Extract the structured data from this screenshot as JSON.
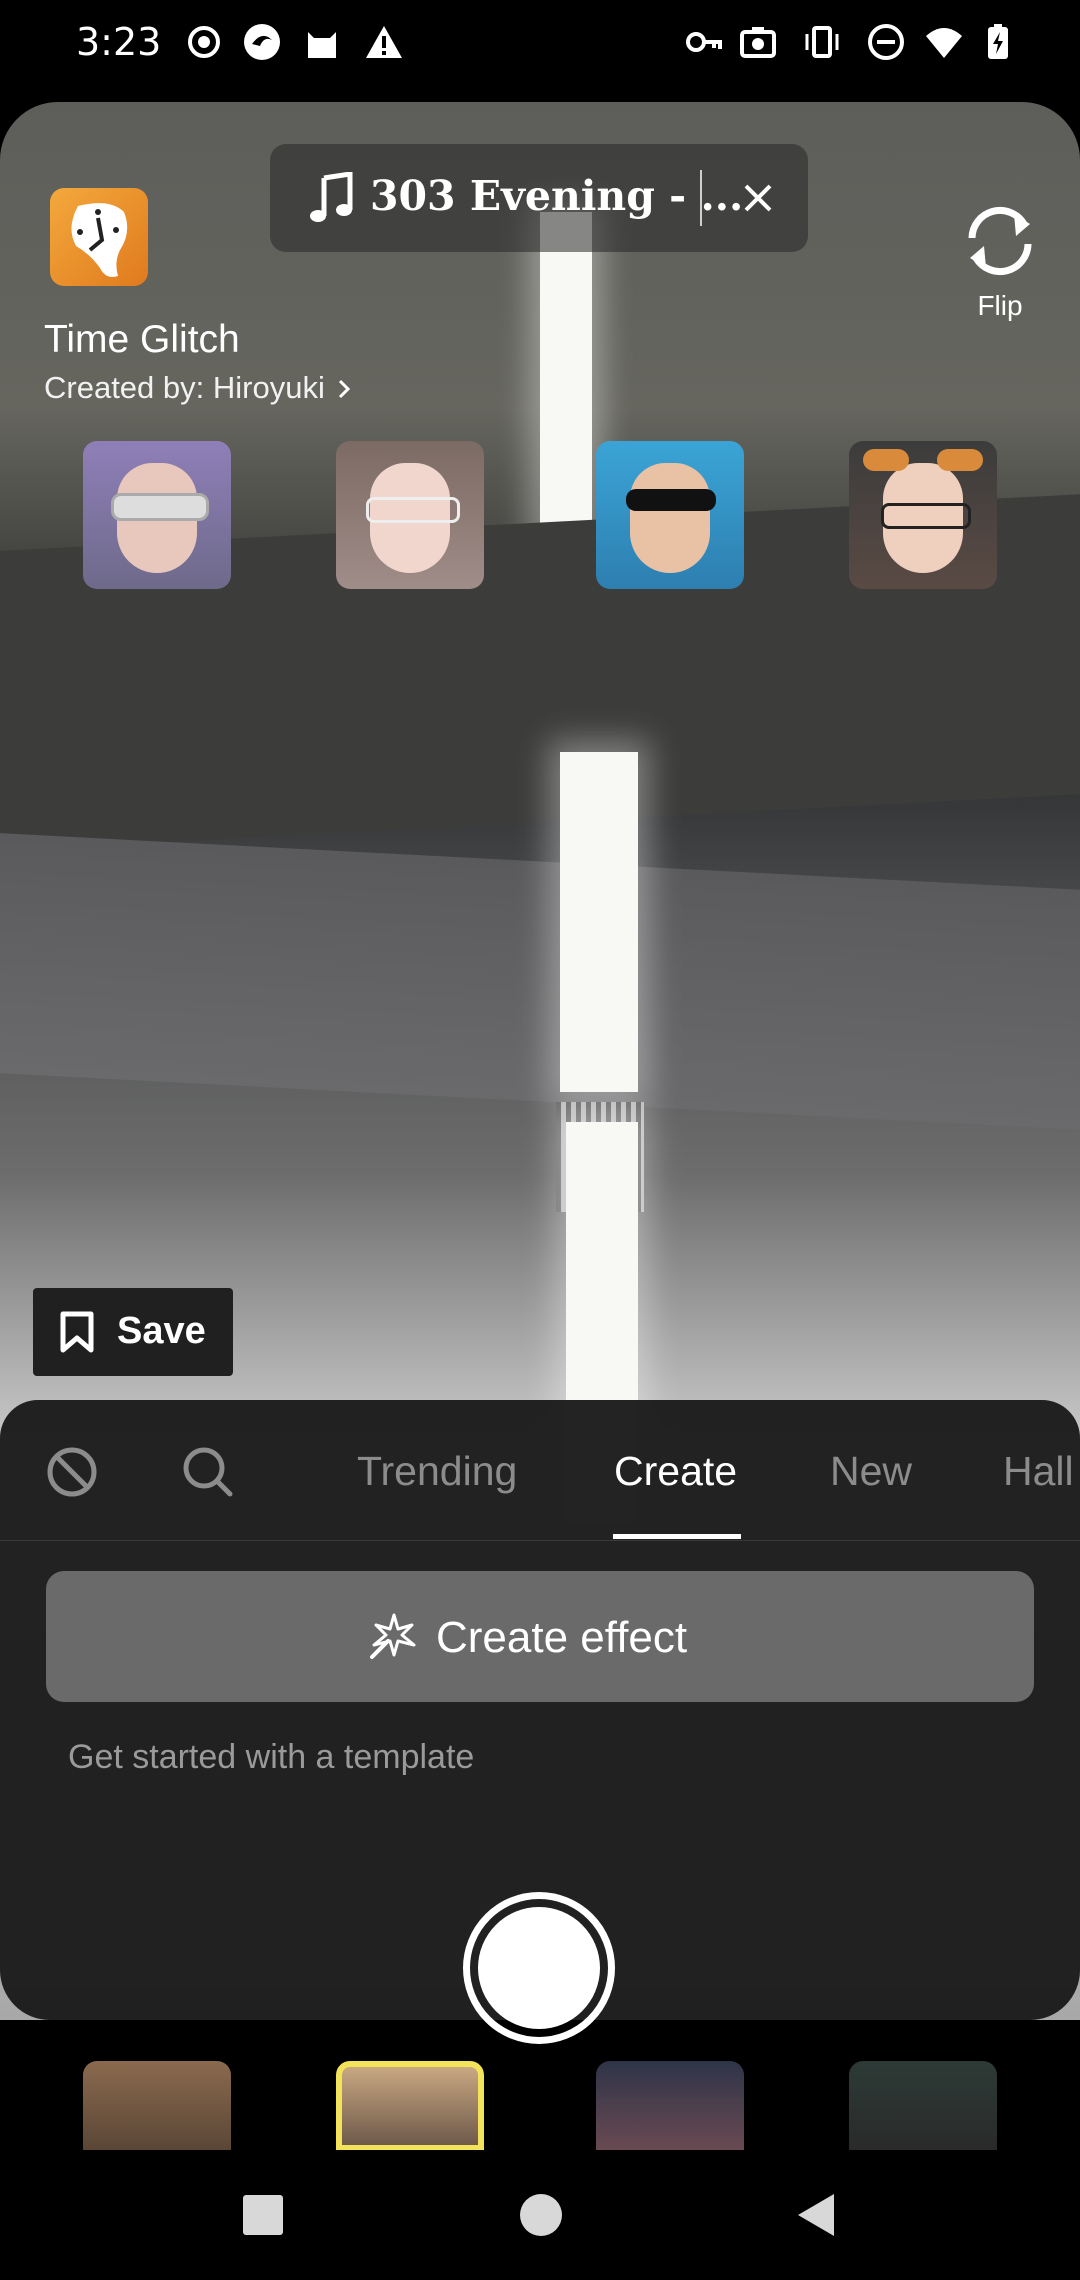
{
  "status_bar": {
    "time": "3:23",
    "icons": [
      "record-icon",
      "app-icon",
      "cat-icon",
      "warning-icon",
      "key-icon",
      "camera-icon",
      "vibrate-icon",
      "dnd-icon",
      "wifi-icon",
      "battery-icon"
    ]
  },
  "effect": {
    "title": "Time Glitch",
    "creator": "Created by: Hiroyuki",
    "icon": "melting-clock-icon"
  },
  "music": {
    "title": "303 Evening - ...",
    "icon": "music-note-icon"
  },
  "flip": {
    "label": "Flip"
  },
  "save": {
    "label": "Save"
  },
  "tabs": {
    "items": [
      "Trending",
      "Create",
      "New",
      "Hall"
    ],
    "active": "Create"
  },
  "create_effect": {
    "label": "Create effect"
  },
  "template_hint": "Get started with a template",
  "colors": {
    "panel": "#1c1c1c",
    "create_button": "#6a6a6a",
    "effect_icon": "#e8902b",
    "selected_border": "#f3e35a"
  },
  "navigation": [
    "recents-button",
    "home-button",
    "back-button"
  ]
}
